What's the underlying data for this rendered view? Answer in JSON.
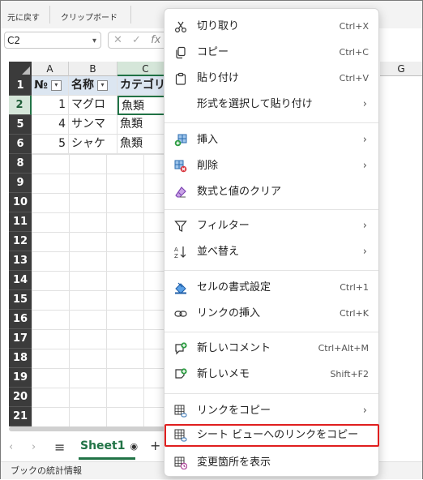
{
  "ribbon": {
    "group1": "元に戻す",
    "group2": "クリップボード"
  },
  "formula_bar": {
    "name_box": "C2",
    "fx": "fx"
  },
  "columns": [
    "A",
    "B",
    "C"
  ],
  "far_column": "G",
  "rows": [
    {
      "num": "1",
      "a": "№",
      "b": "名称",
      "c": "カテゴリ"
    },
    {
      "num": "2",
      "a": "1",
      "b": "マグロ",
      "c": "魚類"
    },
    {
      "num": "5",
      "a": "4",
      "b": "サンマ",
      "c": "魚類"
    },
    {
      "num": "6",
      "a": "5",
      "b": "シャケ",
      "c": "魚類"
    }
  ],
  "empty_rows": [
    "8",
    "9",
    "10",
    "11",
    "12",
    "13",
    "14",
    "15",
    "16",
    "17",
    "18",
    "19",
    "20",
    "21"
  ],
  "sheet_tab": {
    "name": "Sheet1"
  },
  "status_bar": "ブックの統計情報",
  "context_menu": {
    "items": [
      {
        "icon": "scissors-icon",
        "label": "切り取り",
        "shortcut": "Ctrl+X"
      },
      {
        "icon": "copy-icon",
        "label": "コピー",
        "shortcut": "Ctrl+C"
      },
      {
        "icon": "paste-icon",
        "label": "貼り付け",
        "shortcut": "Ctrl+V"
      },
      {
        "icon": "",
        "label": "形式を選択して貼り付け",
        "arrow": "›"
      },
      {
        "icon": "insert-icon",
        "label": "挿入",
        "arrow": "›"
      },
      {
        "icon": "delete-icon",
        "label": "削除",
        "arrow": "›"
      },
      {
        "icon": "eraser-icon",
        "label": "数式と値のクリア"
      },
      {
        "icon": "filter-icon",
        "label": "フィルター",
        "arrow": "›"
      },
      {
        "icon": "sort-icon",
        "label": "並べ替え",
        "arrow": "›"
      },
      {
        "icon": "format-cells-icon",
        "label": "セルの書式設定",
        "shortcut": "Ctrl+1"
      },
      {
        "icon": "link-icon",
        "label": "リンクの挿入",
        "shortcut": "Ctrl+K"
      },
      {
        "icon": "new-comment-icon",
        "label": "新しいコメント",
        "shortcut": "Ctrl+Alt+M"
      },
      {
        "icon": "new-note-icon",
        "label": "新しいメモ",
        "shortcut": "Shift+F2"
      },
      {
        "icon": "copy-link-icon",
        "label": "リンクをコピー",
        "arrow": "›"
      },
      {
        "icon": "sheet-view-link-icon",
        "label": "シート ビューへのリンクをコピー",
        "arrow": "›"
      },
      {
        "icon": "show-changes-icon",
        "label": "変更箇所を表示"
      }
    ]
  },
  "colors": {
    "accent": "#217346",
    "highlight_box": "#e01e1e",
    "header_fill": "#dce6f1"
  }
}
